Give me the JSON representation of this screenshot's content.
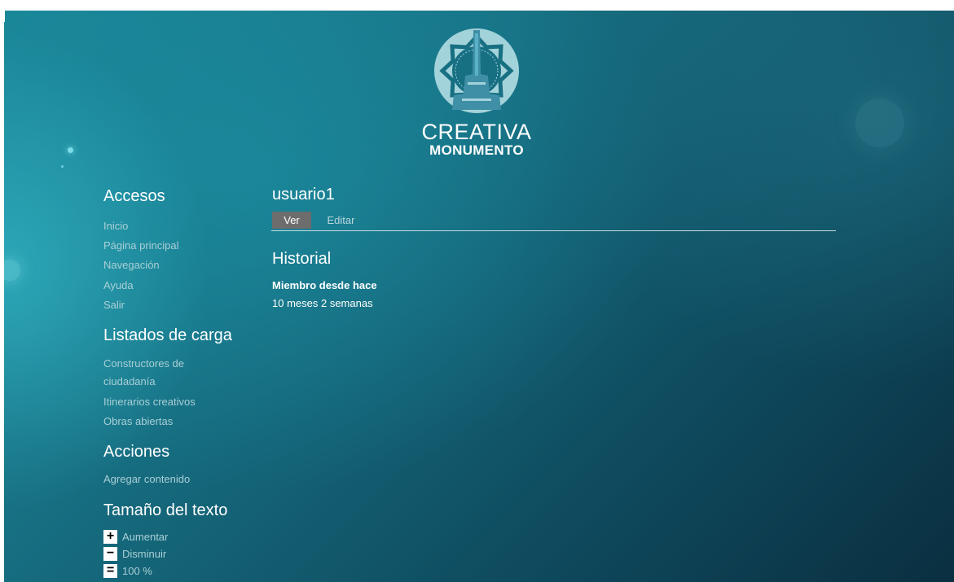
{
  "logo": {
    "title": "CREATIVA",
    "subtitle": "MONUMENTO",
    "icon": "monument-star-logo"
  },
  "sidebar": {
    "accesos": {
      "heading": "Accesos",
      "items": [
        {
          "label": "Inicio"
        },
        {
          "label": "Página principal"
        },
        {
          "label": "Navegación"
        },
        {
          "label": "Ayuda"
        },
        {
          "label": "Salir"
        }
      ]
    },
    "listados": {
      "heading": "Listados de carga",
      "items": [
        {
          "label": "Constructores de ciudadanía"
        },
        {
          "label": "Itinerarios creativos"
        },
        {
          "label": "Obras abiertas"
        }
      ]
    },
    "acciones": {
      "heading": "Acciones",
      "items": [
        {
          "label": "Agregar contenido"
        }
      ]
    },
    "text_size": {
      "heading": "Tamaño del texto",
      "increase_label": "Aumentar",
      "decrease_label": "Disminuir",
      "reset_label": "100 %",
      "increase_icon": "+",
      "decrease_icon": "−",
      "reset_icon": "="
    }
  },
  "main": {
    "title": "usuario1",
    "tabs": [
      {
        "label": "Ver",
        "active": true
      },
      {
        "label": "Editar",
        "active": false
      }
    ],
    "section_title": "Historial",
    "member_since_label": "Miembro desde hace",
    "member_since_value": "10 meses 2 semanas"
  },
  "colors": {
    "background_dark": "#0a2f40",
    "background_light": "#1a8597",
    "link": "#a9cfd6",
    "active_tab": "#6d6d6d",
    "logo_ring": "#a3d3da",
    "logo_monument": "#3f8fa6"
  }
}
